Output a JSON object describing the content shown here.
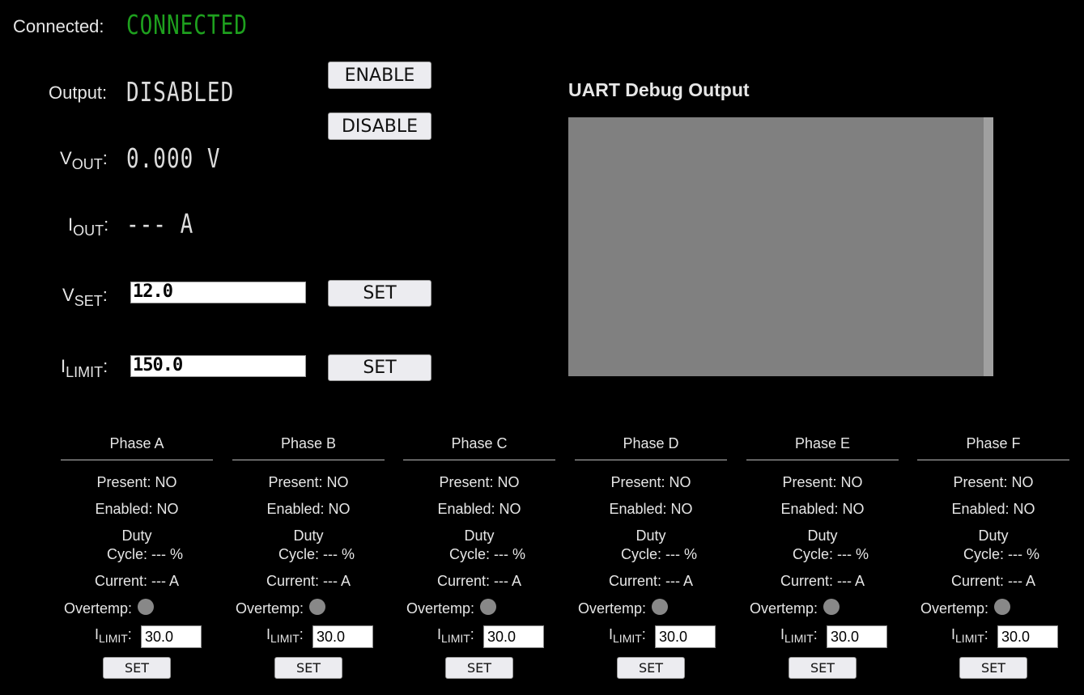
{
  "status": {
    "connected_label": "Connected:",
    "connected_value": "CONNECTED",
    "connected_color": "#1ea01e"
  },
  "output": {
    "label": "Output:",
    "value": "DISABLED",
    "enable_label": "ENABLE",
    "disable_label": "DISABLE"
  },
  "vout": {
    "label_main": "V",
    "label_sub": "OUT",
    "colon": ":",
    "value": "0.000 V"
  },
  "iout": {
    "label_main": "I",
    "label_sub": "OUT",
    "colon": ":",
    "value": "--- A"
  },
  "vset": {
    "label_main": "V",
    "label_sub": "SET",
    "colon": ":",
    "value": "12.0",
    "set_label": "SET"
  },
  "ilimit": {
    "label_main": "I",
    "label_sub": "LIMIT",
    "colon": ":",
    "value": "150.0",
    "set_label": "SET"
  },
  "uart": {
    "title": "UART Debug Output",
    "content": ""
  },
  "phases": [
    {
      "title": "Phase A",
      "present": "Present: NO",
      "enabled": "Enabled: NO",
      "duty_1": "Duty",
      "duty_2": "Cycle: --- %",
      "current": "Current: --- A",
      "overtemp": "Overtemp:",
      "ilimit_main": "I",
      "ilimit_sub": "LIMIT",
      "ilimit_colon": ":",
      "ilimit_value": "30.0",
      "set_label": "SET"
    },
    {
      "title": "Phase B",
      "present": "Present: NO",
      "enabled": "Enabled: NO",
      "duty_1": "Duty",
      "duty_2": "Cycle: --- %",
      "current": "Current: --- A",
      "overtemp": "Overtemp:",
      "ilimit_main": "I",
      "ilimit_sub": "LIMIT",
      "ilimit_colon": ":",
      "ilimit_value": "30.0",
      "set_label": "SET"
    },
    {
      "title": "Phase C",
      "present": "Present: NO",
      "enabled": "Enabled: NO",
      "duty_1": "Duty",
      "duty_2": "Cycle: --- %",
      "current": "Current: --- A",
      "overtemp": "Overtemp:",
      "ilimit_main": "I",
      "ilimit_sub": "LIMIT",
      "ilimit_colon": ":",
      "ilimit_value": "30.0",
      "set_label": "SET"
    },
    {
      "title": "Phase D",
      "present": "Present: NO",
      "enabled": "Enabled: NO",
      "duty_1": "Duty",
      "duty_2": "Cycle: --- %",
      "current": "Current: --- A",
      "overtemp": "Overtemp:",
      "ilimit_main": "I",
      "ilimit_sub": "LIMIT",
      "ilimit_colon": ":",
      "ilimit_value": "30.0",
      "set_label": "SET"
    },
    {
      "title": "Phase E",
      "present": "Present: NO",
      "enabled": "Enabled: NO",
      "duty_1": "Duty",
      "duty_2": "Cycle: --- %",
      "current": "Current: --- A",
      "overtemp": "Overtemp:",
      "ilimit_main": "I",
      "ilimit_sub": "LIMIT",
      "ilimit_colon": ":",
      "ilimit_value": "30.0",
      "set_label": "SET"
    },
    {
      "title": "Phase F",
      "present": "Present: NO",
      "enabled": "Enabled: NO",
      "duty_1": "Duty",
      "duty_2": "Cycle: --- %",
      "current": "Current: --- A",
      "overtemp": "Overtemp:",
      "ilimit_main": "I",
      "ilimit_sub": "LIMIT",
      "ilimit_colon": ":",
      "ilimit_value": "30.0",
      "set_label": "SET"
    }
  ]
}
